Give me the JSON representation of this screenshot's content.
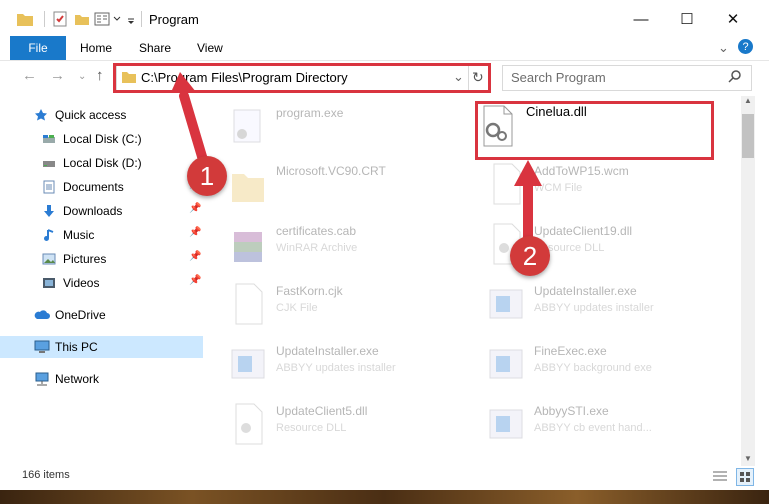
{
  "window": {
    "title": "Program"
  },
  "controls": {
    "minimize": "—",
    "maximize": "☐",
    "close": "✕"
  },
  "ribbon": {
    "file": "File",
    "home": "Home",
    "share": "Share",
    "view": "View",
    "help": "?"
  },
  "address": {
    "path": "C:\\Program Files\\Program Directory"
  },
  "search": {
    "placeholder": "Search Program"
  },
  "sidebar": {
    "items": [
      {
        "label": "Quick access",
        "icon": "star-icon"
      },
      {
        "label": "Local Disk (C:)",
        "icon": "drive-icon"
      },
      {
        "label": "Local Disk (D:)",
        "icon": "drive-icon"
      },
      {
        "label": "Documents",
        "icon": "documents-icon",
        "pinned": true
      },
      {
        "label": "Downloads",
        "icon": "download-icon",
        "pinned": true
      },
      {
        "label": "Music",
        "icon": "music-icon",
        "pinned": true
      },
      {
        "label": "Pictures",
        "icon": "pictures-icon",
        "pinned": true
      },
      {
        "label": "Videos",
        "icon": "videos-icon",
        "pinned": true
      },
      {
        "label": "OneDrive",
        "icon": "cloud-icon"
      },
      {
        "label": "This PC",
        "icon": "computer-icon",
        "selected": true
      },
      {
        "label": "Network",
        "icon": "network-icon"
      }
    ]
  },
  "files": {
    "left": [
      {
        "name": "program.exe",
        "type": ""
      },
      {
        "name": "Microsoft.VC90.CRT",
        "type": ""
      },
      {
        "name": "certificates.cab",
        "type": "WinRAR Archive"
      },
      {
        "name": "FastKorn.cjk",
        "type": "CJK File"
      },
      {
        "name": "UpdateInstaller.exe",
        "type": "ABBYY updates installer"
      },
      {
        "name": "UpdateClient5.dll",
        "type": "Resource DLL"
      }
    ],
    "right": [
      {
        "name": "Cinelua.dll",
        "type": ""
      },
      {
        "name": "AddToWP15.wcm",
        "type": "WCM File"
      },
      {
        "name": "UpdateClient19.dll",
        "type": "Resource DLL"
      },
      {
        "name": "UpdateInstaller.exe",
        "type": "ABBYY updates installer"
      },
      {
        "name": "FineExec.exe",
        "type": "ABBYY background exe"
      },
      {
        "name": "AbbyySTI.exe",
        "type": "ABBYY cb event hand..."
      }
    ]
  },
  "status": {
    "count": "166 items"
  },
  "annotations": {
    "step1": "1",
    "step2": "2"
  },
  "colors": {
    "accent": "#1979ca",
    "annotation": "#d9343f",
    "selected": "#cce8ff"
  }
}
